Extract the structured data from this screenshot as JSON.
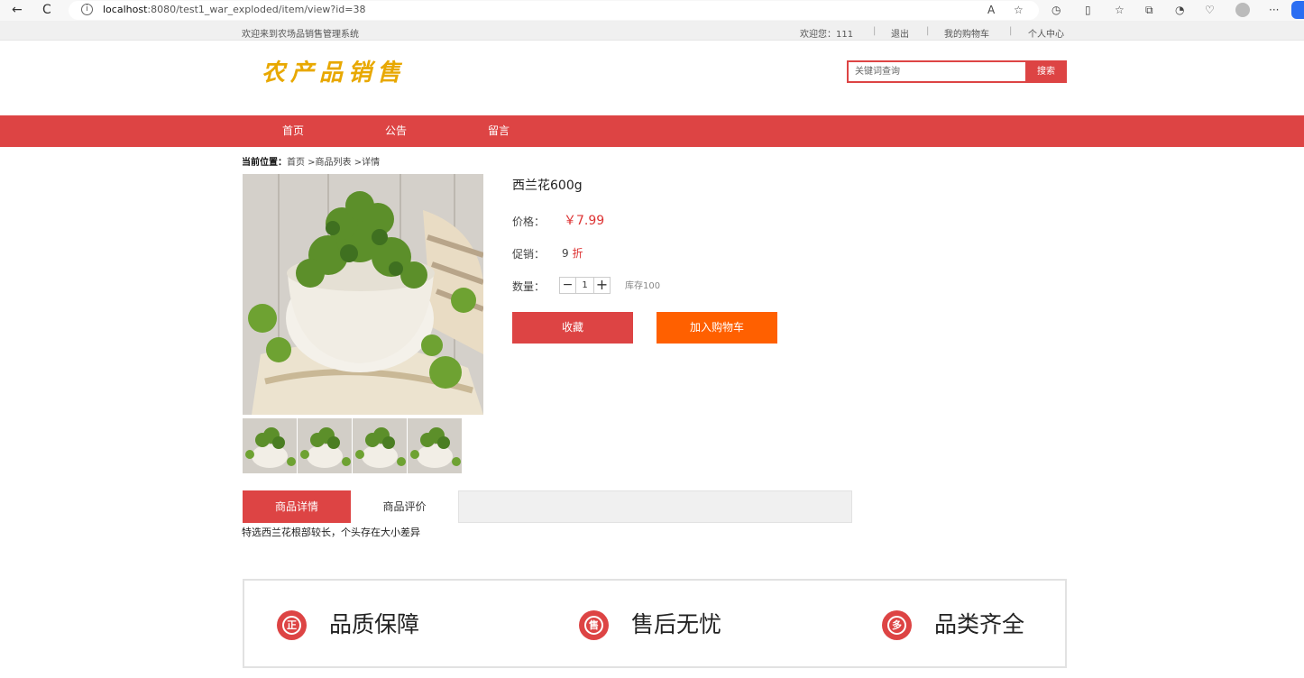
{
  "browser": {
    "url_host": "localhost",
    "url_rest": ":8080/test1_war_exploded/item/view?id=38",
    "back_glyph": "←",
    "refresh_glyph": "C"
  },
  "topbar": {
    "welcome": "欢迎来到农场品销售管理系统",
    "user": "欢迎您：111",
    "logout": "退出",
    "cart": "我的购物车",
    "profile": "个人中心",
    "separator": "|"
  },
  "header": {
    "logo": "农产品销售",
    "search_placeholder": "关键词查询",
    "search_button": "搜索"
  },
  "nav": {
    "items": [
      "首页",
      "公告",
      "留言"
    ]
  },
  "breadcrumb": {
    "label": "当前位置：",
    "path": "首页 >商品列表 >详情"
  },
  "product": {
    "name": "西兰花600g",
    "price_label": "价格：",
    "price": "￥7.99",
    "promo_label": "促销：",
    "promo_value": "9",
    "promo_unit": "折",
    "qty_label": "数量：",
    "qty_minus": "−",
    "qty": "1",
    "qty_plus": "+",
    "stock": "库存100",
    "fav_button": "收藏",
    "cart_button": "加入购物车"
  },
  "tabs": {
    "detail": "商品详情",
    "review": "商品评价"
  },
  "description": "特选西兰花根部较长，个头存在大小差异",
  "guarantees": [
    {
      "icon_char": "正",
      "text": "品质保障"
    },
    {
      "icon_char": "售",
      "text": "售后无忧"
    },
    {
      "icon_char": "多",
      "text": "品类齐全"
    }
  ],
  "colors": {
    "brand_red": "#dd4444",
    "cart_orange": "#ff6000",
    "logo_gold": "#e8a800"
  }
}
